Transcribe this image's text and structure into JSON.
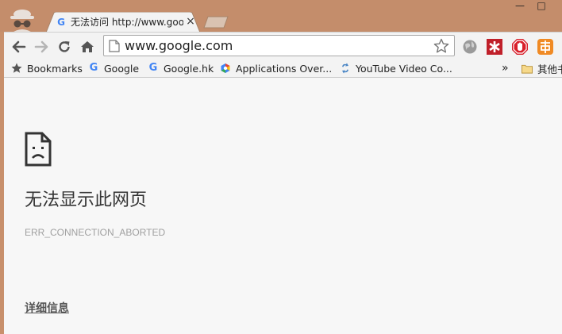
{
  "window": {
    "minimize_glyph": "—",
    "maximize_glyph": "□"
  },
  "tab": {
    "title": "无法访问 http://www.goo",
    "favicon": "G",
    "close_glyph": "×"
  },
  "toolbar": {
    "url": "www.google.com"
  },
  "bookmarks": {
    "items": [
      {
        "label": "Bookmarks",
        "icon": "star-icon"
      },
      {
        "label": "Google",
        "icon": "google-icon"
      },
      {
        "label": "Google.hk",
        "icon": "google-icon"
      },
      {
        "label": "Applications Over...",
        "icon": "applications-icon"
      },
      {
        "label": "YouTube Video Co...",
        "icon": "youtube-converter-icon"
      }
    ],
    "overflow_glyph": "»",
    "other_folder_label": "其他书"
  },
  "page": {
    "error_title": "无法显示此网页",
    "error_code": "ERR_CONNECTION_ABORTED",
    "details_link": "详细信息"
  },
  "colors": {
    "frame": "#c48d6b",
    "toolbar": "#f3f3f3",
    "content_bg": "#f7f7f7",
    "ext_lastpass": "#c0202a",
    "ext_adblock": "#d81f2a",
    "ext_orange": "#f08a24"
  }
}
